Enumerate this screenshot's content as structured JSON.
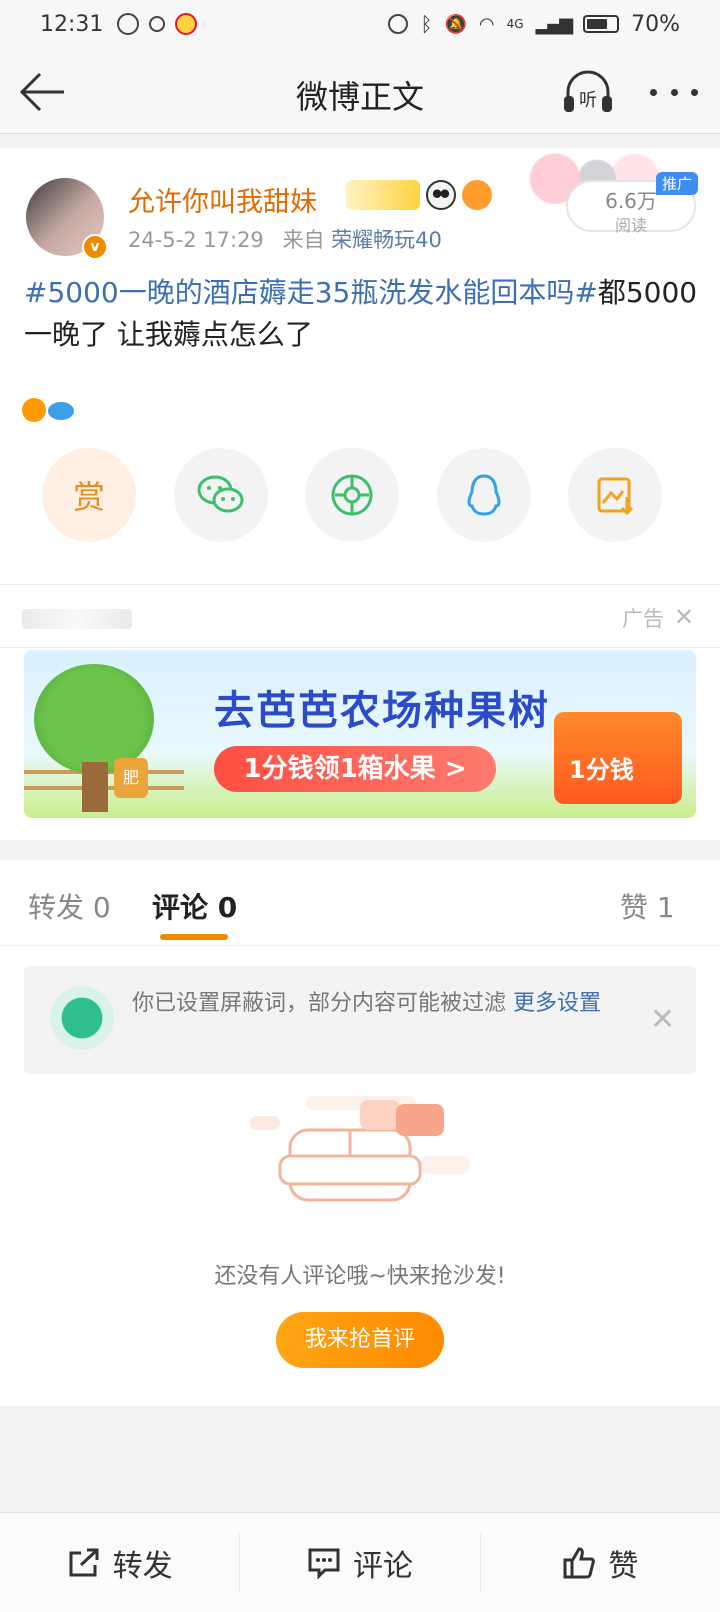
{
  "status_bar": {
    "time": "12:31",
    "battery": "70%",
    "network": "4G"
  },
  "nav": {
    "title": "微博正文",
    "listen_label": "听"
  },
  "post": {
    "username": "允许你叫我甜妹",
    "date": "24-5-2 17:29",
    "source_prefix": "来自",
    "source": "荣耀畅玩40",
    "reads": "6.6万",
    "reads_label": "阅读",
    "promo": "推广",
    "topic": "#5000一晚的酒店薅走35瓶洗发水能回本吗#",
    "body": "都5000一晚了 让我薅点怎么了",
    "reward_label": "赏"
  },
  "ad": {
    "label": "广告",
    "close": "✕",
    "headline": "去芭芭农场种果树",
    "cta": "1分钱领1箱水果 >",
    "box_label": "1分钱",
    "bag_label": "肥"
  },
  "tabs": [
    {
      "label": "转发 0"
    },
    {
      "label": "评论 0"
    },
    {
      "label": "赞 1"
    }
  ],
  "filter_notice": {
    "text": "你已设置屏蔽词，部分内容可能被过滤 ",
    "link": "更多设置",
    "close": "✕"
  },
  "empty": {
    "text": "还没有人评论哦~快来抢沙发!",
    "button": "我来抢首评"
  },
  "bottom_bar": {
    "repost": "转发",
    "comment": "评论",
    "like": "赞"
  }
}
